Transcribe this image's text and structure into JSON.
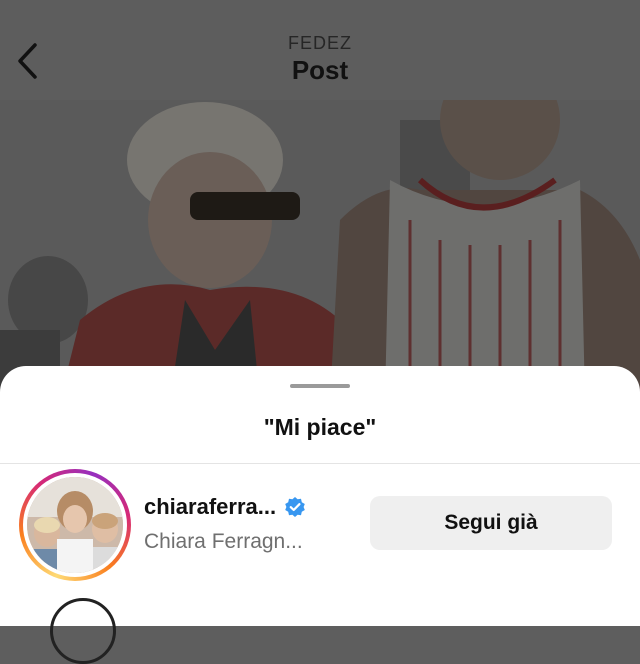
{
  "header": {
    "account": "FEDEZ",
    "title": "Post",
    "back_icon": "chevron-left-icon"
  },
  "sheet": {
    "title": "\"Mi piace\""
  },
  "likes": [
    {
      "username": "chiaraferra...",
      "full_name": "Chiara Ferragn...",
      "verified": true,
      "button_label": "Segui già"
    }
  ],
  "colors": {
    "verified_blue": "#3897f0",
    "button_bg": "#efefef",
    "overlay": "#5e5e5e"
  }
}
